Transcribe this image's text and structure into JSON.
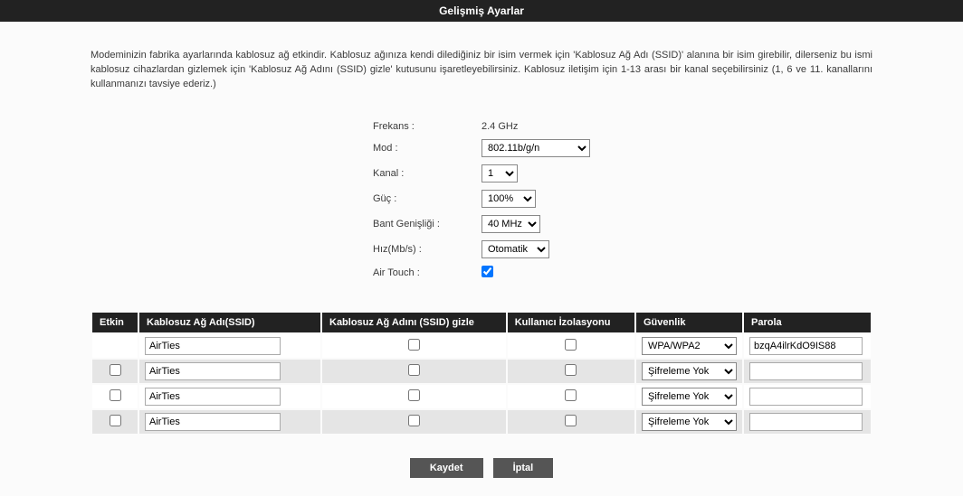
{
  "header": {
    "title": "Gelişmiş Ayarlar"
  },
  "description": "Modeminizin fabrika ayarlarında kablosuz ağ etkindir. Kablosuz ağınıza kendi dilediğiniz bir isim vermek için 'Kablosuz Ağ Adı (SSID)' alanına bir isim girebilir, dilerseniz bu ismi kablosuz cihazlardan gizlemek için 'Kablosuz Ağ Adını (SSID) gizle' kutusunu işaretleyebilirsiniz. Kablosuz iletişim için 1-13 arası bir kanal seçebilirsiniz (1, 6 ve 11. kanallarını kullanmanızı tavsiye ederiz.)",
  "settings": {
    "freq_label": "Frekans :",
    "freq_value": "2.4 GHz",
    "mode_label": "Mod :",
    "mode_value": "802.11b/g/n",
    "channel_label": "Kanal :",
    "channel_value": "1",
    "power_label": "Güç :",
    "power_value": "100%",
    "bw_label": "Bant Genişliği :",
    "bw_value": "40 MHz",
    "rate_label": "Hız(Mb/s) :",
    "rate_value": "Otomatik",
    "airtouch_label": "Air Touch :"
  },
  "columns": {
    "etkin": "Etkin",
    "ssid": "Kablosuz Ağ Adı(SSID)",
    "hide": "Kablosuz Ağ Adını (SSID) gizle",
    "iso": "Kullanıcı İzolasyonu",
    "sec": "Güvenlik",
    "pass": "Parola"
  },
  "rows": [
    {
      "ssid": "AirTies",
      "sec": "WPA/WPA2",
      "pass": "bzqA4ilrKdO9IS88",
      "showEtkin": false,
      "alt": false
    },
    {
      "ssid": "AirTies",
      "sec": "Şifreleme Yok",
      "pass": "",
      "showEtkin": true,
      "alt": true
    },
    {
      "ssid": "AirTies",
      "sec": "Şifreleme Yok",
      "pass": "",
      "showEtkin": true,
      "alt": false
    },
    {
      "ssid": "AirTies",
      "sec": "Şifreleme Yok",
      "pass": "",
      "showEtkin": true,
      "alt": true
    }
  ],
  "buttons": {
    "save": "Kaydet",
    "cancel": "İptal"
  }
}
